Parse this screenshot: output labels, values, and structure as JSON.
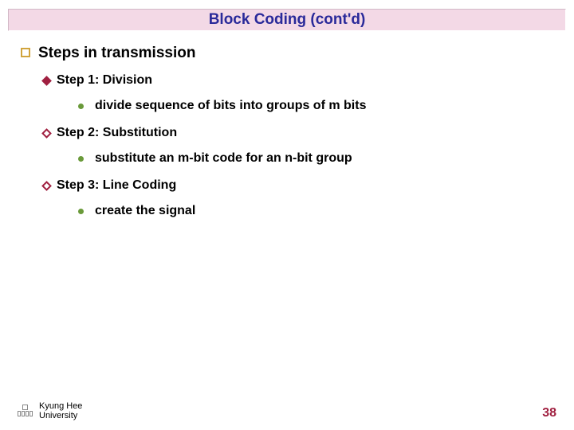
{
  "title": "Block Coding (cont'd)",
  "heading": "Steps in transmission",
  "steps": {
    "s1": {
      "title": "Step 1: Division",
      "detail": "divide sequence of bits into groups of m bits"
    },
    "s2": {
      "title": "Step 2: Substitution",
      "detail": "substitute an m-bit code for an n-bit group"
    },
    "s3": {
      "title": "Step 3: Line Coding",
      "detail": "create the signal"
    }
  },
  "footer": {
    "line1": "Kyung Hee",
    "line2": "University"
  },
  "page": "38"
}
